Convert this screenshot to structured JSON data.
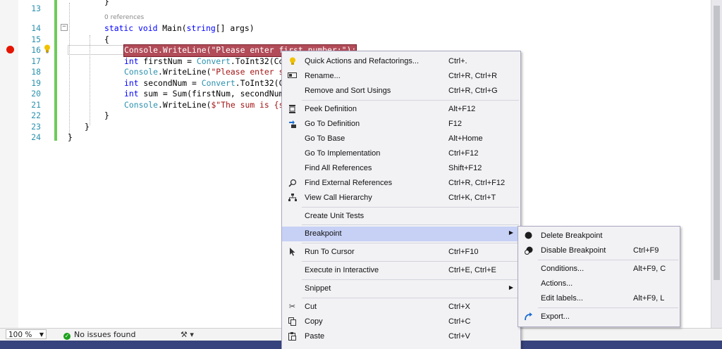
{
  "editor": {
    "codelens": "0 references",
    "lines": [
      {
        "n": "13"
      },
      {
        "n": "14"
      },
      {
        "n": "15"
      },
      {
        "n": "16"
      },
      {
        "n": "17"
      },
      {
        "n": "18"
      },
      {
        "n": "19"
      },
      {
        "n": "20"
      },
      {
        "n": "21"
      },
      {
        "n": "22"
      },
      {
        "n": "23"
      },
      {
        "n": "24"
      }
    ],
    "code": {
      "l13": "}",
      "l14a": "static",
      "l14b": "void",
      "l14c": " Main(",
      "l14d": "string",
      "l14e": "[] args)",
      "l15": "{",
      "l16a": "Console",
      "l16b": ".WriteLine(",
      "l16c": "\"Please enter first number:\"",
      "l16d": ");",
      "l17a": "int",
      "l17b": " firstNum = ",
      "l17c": "Convert",
      "l17d": ".ToInt32(Co",
      "l18a": "Console",
      "l18b": ".WriteLine(",
      "l18c": "\"Please enter se",
      "l19a": "int",
      "l19b": " secondNum = ",
      "l19c": "Convert",
      "l19d": ".ToInt32(Co",
      "l20a": "int",
      "l20b": " sum = Sum(firstNum, secondNum",
      "l21a": "Console",
      "l21b": ".WriteLine(",
      "l21c": "$\"The sum is {su",
      "l22": "}",
      "l23": "}",
      "l24": "}"
    }
  },
  "status": {
    "zoom": "100 %",
    "issues": "No issues found"
  },
  "context_menu": {
    "items": [
      {
        "label": "Quick Actions and Refactorings...",
        "shortcut": "Ctrl+.",
        "icon": "lightbulb-icon"
      },
      {
        "label": "Rename...",
        "shortcut": "Ctrl+R, Ctrl+R",
        "icon": "rename-icon"
      },
      {
        "label": "Remove and Sort Usings",
        "shortcut": "Ctrl+R, Ctrl+G"
      },
      {
        "label": "Peek Definition",
        "shortcut": "Alt+F12",
        "icon": "peek-icon"
      },
      {
        "label": "Go To Definition",
        "shortcut": "F12",
        "icon": "goto-definition-icon"
      },
      {
        "label": "Go To Base",
        "shortcut": "Alt+Home"
      },
      {
        "label": "Go To Implementation",
        "shortcut": "Ctrl+F12"
      },
      {
        "label": "Find All References",
        "shortcut": "Shift+F12"
      },
      {
        "label": "Find External References",
        "shortcut": "Ctrl+R, Ctrl+F12",
        "icon": "find-icon"
      },
      {
        "label": "View Call Hierarchy",
        "shortcut": "Ctrl+K, Ctrl+T",
        "icon": "hierarchy-icon"
      },
      {
        "label": "Create Unit Tests",
        "shortcut": ""
      },
      {
        "label": "Breakpoint",
        "shortcut": ""
      },
      {
        "label": "Run To Cursor",
        "shortcut": "Ctrl+F10",
        "icon": "cursor-icon"
      },
      {
        "label": "Execute in Interactive",
        "shortcut": "Ctrl+E, Ctrl+E"
      },
      {
        "label": "Snippet",
        "shortcut": ""
      },
      {
        "label": "Cut",
        "shortcut": "Ctrl+X",
        "icon": "cut-icon"
      },
      {
        "label": "Copy",
        "shortcut": "Ctrl+C",
        "icon": "copy-icon"
      },
      {
        "label": "Paste",
        "shortcut": "Ctrl+V",
        "icon": "paste-icon"
      }
    ]
  },
  "breakpoint_submenu": {
    "items": [
      {
        "label": "Delete Breakpoint",
        "shortcut": "",
        "icon": "breakpoint-dot-icon"
      },
      {
        "label": "Disable Breakpoint",
        "shortcut": "Ctrl+F9",
        "icon": "disable-breakpoint-icon"
      },
      {
        "label": "Conditions...",
        "shortcut": "Alt+F9, C"
      },
      {
        "label": "Actions...",
        "shortcut": ""
      },
      {
        "label": "Edit labels...",
        "shortcut": "Alt+F9, L"
      },
      {
        "label": "Export...",
        "shortcut": "",
        "icon": "export-icon"
      }
    ]
  },
  "colors": {
    "keyword": "#0000ff",
    "type": "#2b91af",
    "string": "#a31515",
    "breakpoint": "#e51400",
    "selection": "#b14c58",
    "menu_highlight": "#c7d1f6",
    "status_strip": "#37437c"
  }
}
